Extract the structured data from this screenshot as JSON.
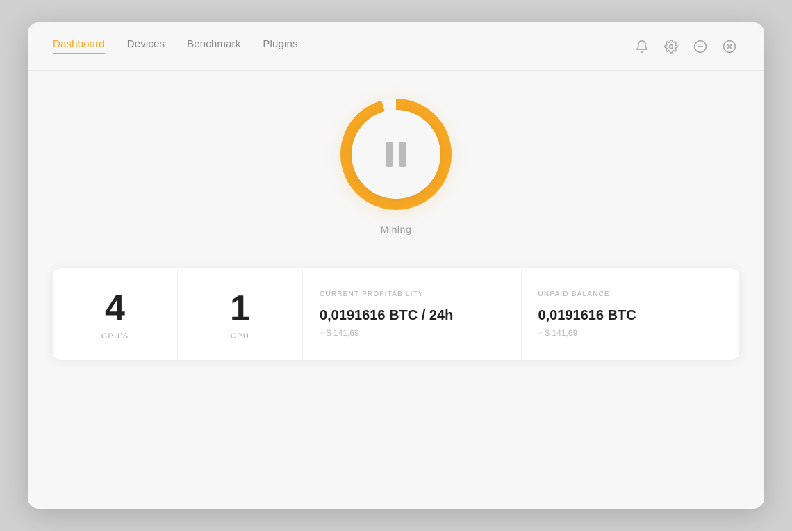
{
  "nav": {
    "tabs": [
      {
        "label": "Dashboard",
        "active": true
      },
      {
        "label": "Devices",
        "active": false
      },
      {
        "label": "Benchmark",
        "active": false
      },
      {
        "label": "Plugins",
        "active": false
      }
    ]
  },
  "header_icons": {
    "bell": "🔔",
    "gear": "⚙",
    "minimize": "⊖",
    "close": "⊗"
  },
  "mining": {
    "label": "Mining"
  },
  "stats": {
    "gpu": {
      "value": "4",
      "label": "GPU'S"
    },
    "cpu": {
      "value": "1",
      "label": "CPU"
    },
    "profitability": {
      "section_label": "CURRENT PROFITABILITY",
      "value": "0,0191616 BTC / 24h",
      "approx": "≈ $ 141,69"
    },
    "balance": {
      "section_label": "UNPAID BALANCE",
      "value": "0,0191616 BTC",
      "approx": "≈ $ 141,69"
    }
  }
}
